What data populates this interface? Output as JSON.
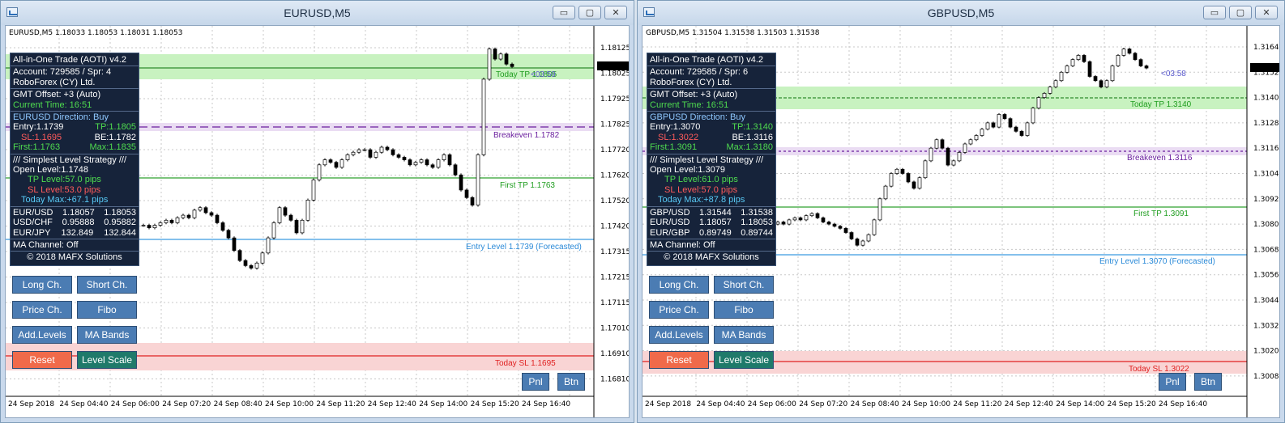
{
  "windows": [
    {
      "title": "EURUSD,M5",
      "ohlc": "EURUSD,M5  1.18033 1.18053 1.18031 1.18053",
      "panel": {
        "name": "All-in-One Trade (AOTI) v4.2",
        "account": "Account: 729585 / Spr: 4",
        "broker": "RoboForex (CY) Ltd.",
        "gmt": "GMT Offset: +3 (Auto)",
        "time": "Current Time: 16:51",
        "direction": "EURUSD Direction: Buy",
        "entry": "Entry:1.1739",
        "tp": "TP:1.1805",
        "sl": "SL:1.1695",
        "be": "BE:1.1782",
        "first": "First:1.1763",
        "max": "Max:1.1835",
        "strategy": "/// Simplest Level Strategy ///",
        "open_level": "Open Level:1.1748",
        "tp_level": "TP Level:57.0 pips",
        "sl_level": "SL Level:53.0 pips",
        "today_max": "Today Max:+67.1 pips",
        "quotes": [
          {
            "sym": "EUR/USD",
            "bid": "1.18057",
            "ask": "1.18053"
          },
          {
            "sym": "USD/CHF",
            "bid": "0.95888",
            "ask": "0.95882"
          },
          {
            "sym": "EUR/JPY",
            "bid": "132.849",
            "ask": "132.844"
          }
        ],
        "ma_channel": "MA Channel: Off",
        "copyright": "© 2018 MAFX Solutions"
      },
      "price_axis": [
        "1.18125",
        "1.18025",
        "1.17925",
        "1.17825",
        "1.17720",
        "1.17620",
        "1.17520",
        "1.17420",
        "1.17315",
        "1.17215",
        "1.17115",
        "1.17010",
        "1.16910",
        "1.16810"
      ],
      "current_price": "1.18053",
      "time_axis": [
        "24 Sep 2018",
        "24 Sep 04:40",
        "24 Sep 06:00",
        "24 Sep 07:20",
        "24 Sep 08:40",
        "24 Sep 10:00",
        "24 Sep 11:20",
        "24 Sep 12:40",
        "24 Sep 14:00",
        "24 Sep 15:20",
        "24 Sep 16:40"
      ],
      "levels": {
        "today_tp": "Today TP 1.1805",
        "countdown": "<03:59",
        "breakeven": "Breakeven 1.1782",
        "first_tp": "First TP 1.1763",
        "entry": "Entry Level 1.1739 (Forecasted)",
        "today_sl": "Today SL 1.1695"
      },
      "closes": [
        1.1742,
        1.1741,
        1.1742,
        1.1743,
        1.1744,
        1.1743,
        1.1745,
        1.1746,
        1.1745,
        1.1748,
        1.1749,
        1.1747,
        1.1746,
        1.1743,
        1.174,
        1.1737,
        1.1732,
        1.1728,
        1.1726,
        1.1725,
        1.1727,
        1.1731,
        1.1737,
        1.1743,
        1.1749,
        1.1746,
        1.1744,
        1.1739,
        1.1744,
        1.1752,
        1.176,
        1.1766,
        1.1768,
        1.1767,
        1.1765,
        1.1768,
        1.177,
        1.1771,
        1.1772,
        1.1772,
        1.1769,
        1.1771,
        1.1773,
        1.1772,
        1.177,
        1.1769,
        1.1768,
        1.1766,
        1.1767,
        1.1768,
        1.1766,
        1.1765,
        1.1768,
        1.177,
        1.1766,
        1.1762,
        1.1756,
        1.1753,
        1.175,
        1.177,
        1.18,
        1.1812,
        1.1808,
        1.181,
        1.1806,
        1.1805
      ]
    },
    {
      "title": "GBPUSD,M5",
      "ohlc": "GBPUSD,M5  1.31504 1.31538 1.31503 1.31538",
      "panel": {
        "name": "All-in-One Trade (AOTI) v4.2",
        "account": "Account: 729585 / Spr: 6",
        "broker": "RoboForex (CY) Ltd.",
        "gmt": "GMT Offset: +3 (Auto)",
        "time": "Current Time: 16:51",
        "direction": "GBPUSD Direction: Buy",
        "entry": "Entry:1.3070",
        "tp": "TP:1.3140",
        "sl": "SL:1.3022",
        "be": "BE:1.3116",
        "first": "First:1.3091",
        "max": "Max:1.3180",
        "strategy": "/// Simplest Level Strategy ///",
        "open_level": "Open Level:1.3079",
        "tp_level": "TP Level:61.0 pips",
        "sl_level": "SL Level:57.0 pips",
        "today_max": "Today Max:+87.8 pips",
        "quotes": [
          {
            "sym": "GBP/USD",
            "bid": "1.31544",
            "ask": "1.31538"
          },
          {
            "sym": "EUR/USD",
            "bid": "1.18057",
            "ask": "1.18053"
          },
          {
            "sym": "EUR/GBP",
            "bid": "0.89749",
            "ask": "0.89744"
          }
        ],
        "ma_channel": "MA Channel: Off",
        "copyright": "© 2018 MAFX Solutions"
      },
      "price_axis": [
        "1.31640",
        "1.31520",
        "1.31400",
        "1.31280",
        "1.31160",
        "1.31040",
        "1.30920",
        "1.30800",
        "1.30680",
        "1.30560",
        "1.30440",
        "1.30320",
        "1.30200",
        "1.30080"
      ],
      "current_price": "1.31538",
      "time_axis": [
        "24 Sep 2018",
        "24 Sep 04:40",
        "24 Sep 06:00",
        "24 Sep 07:20",
        "24 Sep 08:40",
        "24 Sep 10:00",
        "24 Sep 11:20",
        "24 Sep 12:40",
        "24 Sep 14:00",
        "24 Sep 15:20",
        "24 Sep 16:40"
      ],
      "levels": {
        "today_tp": "Today TP 1.3140",
        "countdown": "<03:58",
        "breakeven": "Breakeven 1.3116",
        "first_tp": "First TP 1.3091",
        "entry": "Entry Level 1.3070 (Forecasted)",
        "today_sl": "Today SL 1.3022"
      },
      "closes": [
        1.308,
        1.3081,
        1.308,
        1.3082,
        1.3083,
        1.3082,
        1.3084,
        1.3085,
        1.3083,
        1.3081,
        1.308,
        1.3079,
        1.3078,
        1.3076,
        1.3073,
        1.307,
        1.3072,
        1.3075,
        1.3082,
        1.3092,
        1.3098,
        1.3104,
        1.3106,
        1.3104,
        1.31,
        1.3097,
        1.3102,
        1.311,
        1.3116,
        1.312,
        1.3116,
        1.3108,
        1.311,
        1.3114,
        1.3118,
        1.312,
        1.3122,
        1.3125,
        1.3128,
        1.3126,
        1.3132,
        1.313,
        1.3126,
        1.3124,
        1.3122,
        1.3128,
        1.3135,
        1.314,
        1.3142,
        1.3145,
        1.3148,
        1.3152,
        1.3155,
        1.3158,
        1.316,
        1.3157,
        1.315,
        1.3148,
        1.3145,
        1.3148,
        1.3155,
        1.316,
        1.3163,
        1.3161,
        1.3158,
        1.3155,
        1.3154
      ]
    }
  ],
  "buttons": {
    "long": "Long Ch.",
    "short": "Short Ch.",
    "price": "Price Ch.",
    "fibo": "Fibo",
    "add_levels": "Add.Levels",
    "ma_bands": "MA Bands",
    "reset": "Reset",
    "level_scale": "Level Scale",
    "pnl": "Pnl",
    "btn": "Btn"
  },
  "window_controls": {
    "minimize": "▭",
    "maximize": "▢",
    "close": "✕"
  }
}
